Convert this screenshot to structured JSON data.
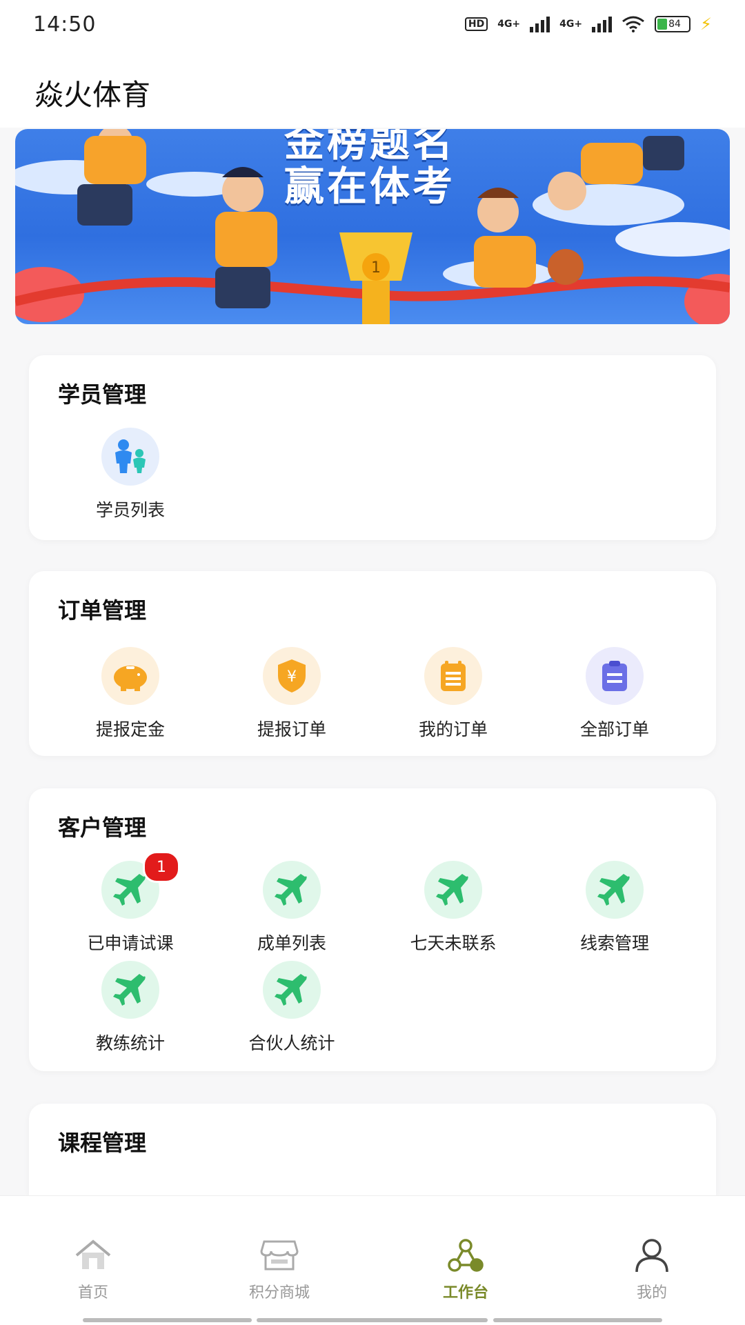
{
  "status_bar": {
    "time": "14:50",
    "battery": "84",
    "network1": "4G+",
    "network2": "4G+",
    "hd": "HD"
  },
  "header": {
    "title": "焱火体育"
  },
  "banner": {
    "slogan_top": "金榜题名",
    "slogan_main": "赢在体考"
  },
  "sections": {
    "student": {
      "title": "学员管理",
      "items": [
        {
          "label": "学员列表",
          "icon": "students-icon"
        }
      ]
    },
    "order": {
      "title": "订单管理",
      "items": [
        {
          "label": "提报定金",
          "icon": "piggy-bank-icon"
        },
        {
          "label": "提报订单",
          "icon": "yuan-shield-icon"
        },
        {
          "label": "我的订单",
          "icon": "calendar-list-icon"
        },
        {
          "label": "全部订单",
          "icon": "clipboard-icon"
        }
      ]
    },
    "customer": {
      "title": "客户管理",
      "items": [
        {
          "label": "已申请试课",
          "icon": "plane-icon",
          "badge": "1"
        },
        {
          "label": "成单列表",
          "icon": "plane-icon"
        },
        {
          "label": "七天未联系",
          "icon": "plane-icon"
        },
        {
          "label": "线索管理",
          "icon": "plane-icon"
        },
        {
          "label": "教练统计",
          "icon": "plane-icon"
        },
        {
          "label": "合伙人统计",
          "icon": "plane-icon"
        }
      ]
    },
    "course": {
      "title": "课程管理"
    }
  },
  "tabbar": {
    "tabs": [
      {
        "label": "首页",
        "icon": "home-icon"
      },
      {
        "label": "积分商城",
        "icon": "store-icon"
      },
      {
        "label": "工作台",
        "icon": "workbench-icon",
        "active": true
      },
      {
        "label": "我的",
        "icon": "user-icon"
      }
    ]
  },
  "colors": {
    "accent": "#7a8a2a",
    "badge": "#e21b1b",
    "green_icon": "#2dbd6e",
    "orange_icon": "#f6a623",
    "purple_icon": "#6b6fe6"
  }
}
